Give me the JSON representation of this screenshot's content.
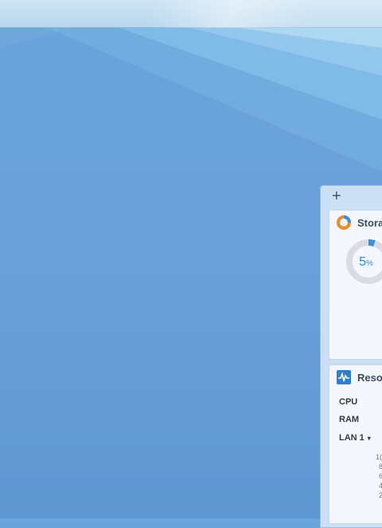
{
  "desktop": {
    "background_color": "#6aa4dc"
  },
  "widget_panel": {
    "add_label": "+",
    "storage_card": {
      "title": "Stora",
      "icon": "storage-donut-icon",
      "usage_percent": 5,
      "usage_number": "5",
      "usage_unit": "%"
    },
    "resource_card": {
      "title": "Reso",
      "icon": "resource-monitor-icon",
      "rows": [
        "CPU",
        "RAM",
        "LAN 1"
      ],
      "lan_caret": "▾",
      "y_ticks": [
        "1(",
        "8",
        "6",
        "4",
        "2"
      ]
    }
  }
}
